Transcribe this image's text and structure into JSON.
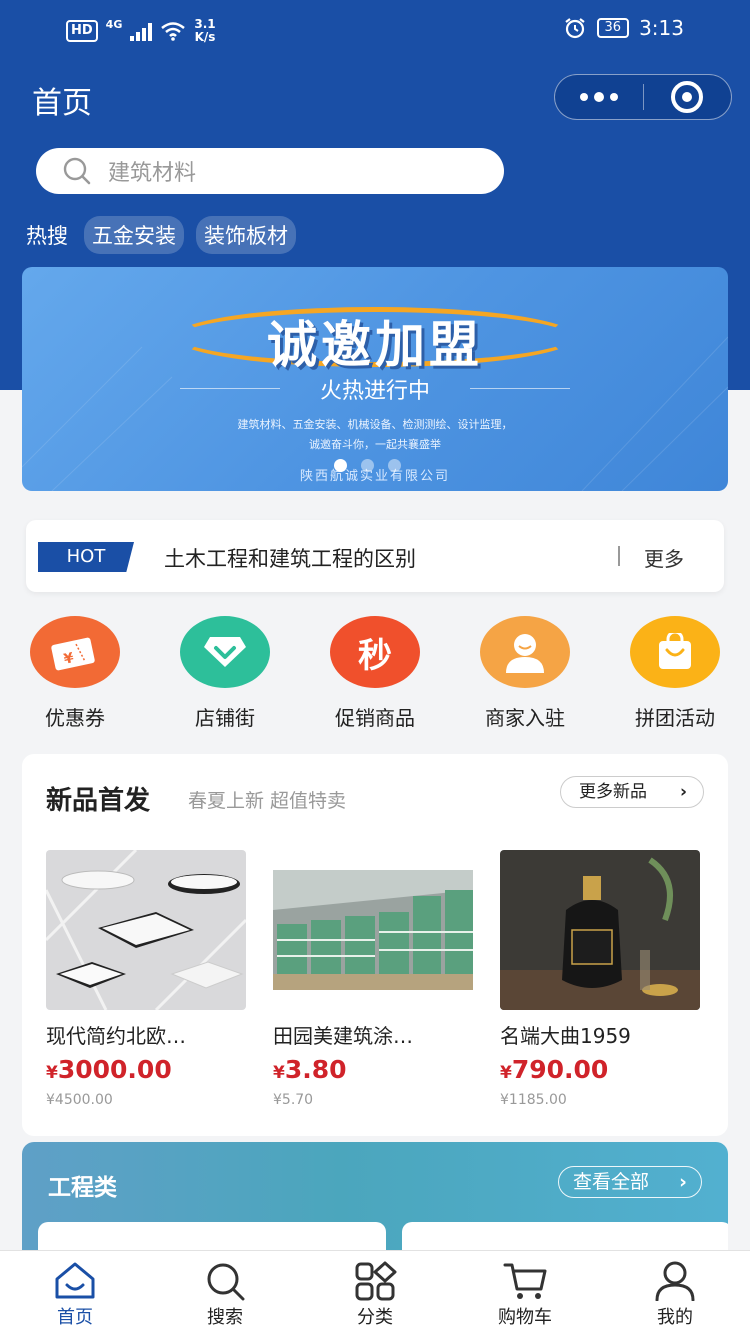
{
  "status_bar": {
    "hd": "HD",
    "network": "4G",
    "speed_value": "3.1",
    "speed_unit": "K/s",
    "battery": "36",
    "time": "3:13"
  },
  "header": {
    "title": "首页",
    "search_placeholder": "建筑材料",
    "hot_label": "热搜",
    "hot_tags": [
      "五金安装",
      "装饰板材"
    ]
  },
  "banner": {
    "title": "诚邀加盟",
    "subtitle": "火热进行中",
    "desc_line1": "建筑材料、五金安装、机械设备、检测测绘、设计监理，",
    "desc_line2": "诚邀奋斗你，一起共襄盛举",
    "company": "陕西航诚实业有限公司",
    "slide_count": 3,
    "active_slide": 1
  },
  "notice": {
    "badge": "HOT",
    "text": "土木工程和建筑工程的区别",
    "more": "更多"
  },
  "quick_entries": [
    {
      "label": "优惠券",
      "icon": "coupon-ticket-icon",
      "color": "#f26a35"
    },
    {
      "label": "店铺街",
      "icon": "diamond-store-icon",
      "color": "#2dbf9a"
    },
    {
      "label": "促销商品",
      "icon": "flash-sale-icon",
      "color": "#f0502c",
      "glyph": "秒"
    },
    {
      "label": "商家入驻",
      "icon": "merchant-person-icon",
      "color": "#f5a445"
    },
    {
      "label": "拼团活动",
      "icon": "group-bag-icon",
      "color": "#fbb217"
    }
  ],
  "new_products": {
    "title": "新品首发",
    "subtitle": "春夏上新 超值特卖",
    "more": "更多新品",
    "items": [
      {
        "name": "现代简约北欧…",
        "price": "3000.00",
        "old_price": "¥4500.00",
        "currency": "¥"
      },
      {
        "name": "田园美建筑涂…",
        "price": "3.80",
        "old_price": "¥5.70",
        "currency": "¥"
      },
      {
        "name": "名端大曲1959",
        "price": "790.00",
        "old_price": "¥1185.00",
        "currency": "¥"
      }
    ]
  },
  "project_section": {
    "title": "工程类",
    "more": "查看全部"
  },
  "tabbar": {
    "items": [
      {
        "label": "首页",
        "icon": "home-icon",
        "active": true
      },
      {
        "label": "搜索",
        "icon": "search-icon",
        "active": false
      },
      {
        "label": "分类",
        "icon": "category-icon",
        "active": false
      },
      {
        "label": "购物车",
        "icon": "cart-icon",
        "active": false
      },
      {
        "label": "我的",
        "icon": "profile-icon",
        "active": false
      }
    ]
  },
  "colors": {
    "primary": "#1a4fa6",
    "price": "#d0232a",
    "background": "#f3f4f6"
  }
}
